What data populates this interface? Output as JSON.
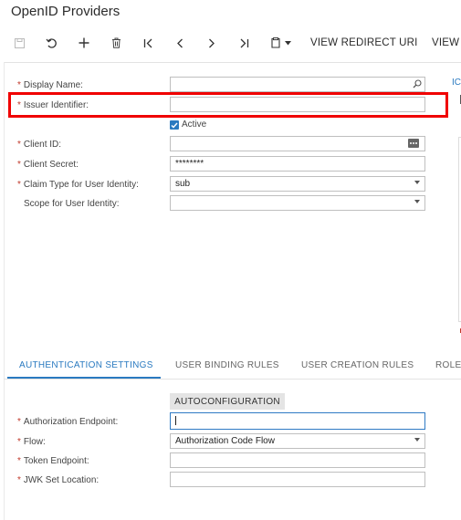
{
  "page": {
    "title": "OpenID Providers"
  },
  "toolbar": {
    "view_redirect_uri": "VIEW REDIRECT URI",
    "view_more": "VIEW"
  },
  "form": {
    "display_name": {
      "label": "Display Name:",
      "value": "",
      "required": true
    },
    "issuer_identifier": {
      "label": "Issuer Identifier:",
      "value": "",
      "required": true
    },
    "active": {
      "label": "Active",
      "checked": true
    },
    "client_id": {
      "label": "Client ID:",
      "value": "",
      "required": true
    },
    "client_secret": {
      "label": "Client Secret:",
      "value": "********",
      "required": true
    },
    "claim_type": {
      "label": "Claim Type for User Identity:",
      "value": "sub",
      "required": true
    },
    "scope": {
      "label": "Scope for User Identity:",
      "value": ""
    }
  },
  "right_panel": {
    "link": "IC"
  },
  "tabs": [
    {
      "label": "AUTHENTICATION SETTINGS",
      "active": true
    },
    {
      "label": "USER BINDING RULES"
    },
    {
      "label": "USER CREATION RULES"
    },
    {
      "label": "ROLE"
    }
  ],
  "auth": {
    "autoconfiguration": "AUTOCONFIGURATION",
    "authorization_endpoint": {
      "label": "Authorization Endpoint:",
      "value": "",
      "required": true
    },
    "flow": {
      "label": "Flow:",
      "value": "Authorization Code Flow",
      "required": true
    },
    "token_endpoint": {
      "label": "Token Endpoint:",
      "value": "",
      "required": true
    },
    "jwk_set_location": {
      "label": "JWK Set Location:",
      "value": "",
      "required": true
    }
  },
  "colors": {
    "accent": "#2a7ac0",
    "highlight": "#f00000",
    "required": "#c0392b"
  }
}
